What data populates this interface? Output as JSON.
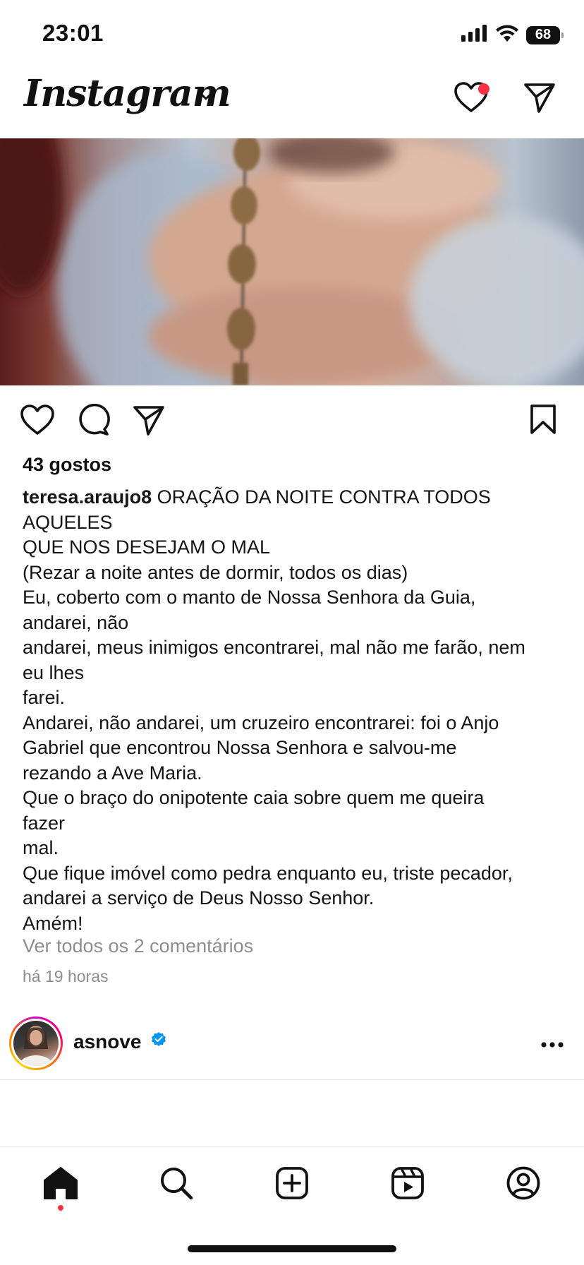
{
  "status_bar": {
    "time": "23:01",
    "battery": "68",
    "icons": [
      "cellular-signal-icon",
      "wifi-icon",
      "battery-icon"
    ]
  },
  "header": {
    "logo": "Instagram",
    "icons": [
      "chevron-down-icon",
      "heart-icon",
      "send-icon"
    ],
    "notification_dot_color": "#ff3040"
  },
  "post": {
    "image_description_icon": "rosary-photo",
    "actions": [
      "heart-icon",
      "comment-icon",
      "share-icon",
      "bookmark-icon"
    ],
    "likes": "43 gostos",
    "username": "teresa.araujo8",
    "caption_first": "ORAÇÃO DA NOITE CONTRA TODOS",
    "caption_lines": [
      "AQUELES",
      "QUE NOS DESEJAM O MAL",
      "(Rezar a noite antes de dormir, todos os dias)",
      "Eu, coberto com o manto de Nossa Senhora da Guia,",
      "andarei, não",
      "andarei, meus inimigos encontrarei, mal não me farão, nem",
      "eu lhes",
      "farei.",
      "Andarei, não andarei, um cruzeiro encontrarei: foi o Anjo",
      "Gabriel que encontrou Nossa Senhora e salvou-me",
      "rezando a Ave Maria.",
      "Que o braço do onipotente caia sobre quem me queira",
      "fazer",
      "mal.",
      "Que fique imóvel como pedra enquanto eu, triste pecador,",
      "andarei a serviço de Deus Nosso Senhor.",
      "Amém!"
    ],
    "view_comments": "Ver todos os 2 comentários",
    "time_ago": "há 19 horas"
  },
  "next_post": {
    "username": "asnove",
    "verified_color": "#0095f6",
    "icons": [
      "verified-badge-icon",
      "more-icon"
    ]
  },
  "bottom_nav": {
    "items": [
      "home-icon",
      "search-icon",
      "create-icon",
      "reels-icon",
      "profile-icon"
    ],
    "active": "home-icon"
  }
}
